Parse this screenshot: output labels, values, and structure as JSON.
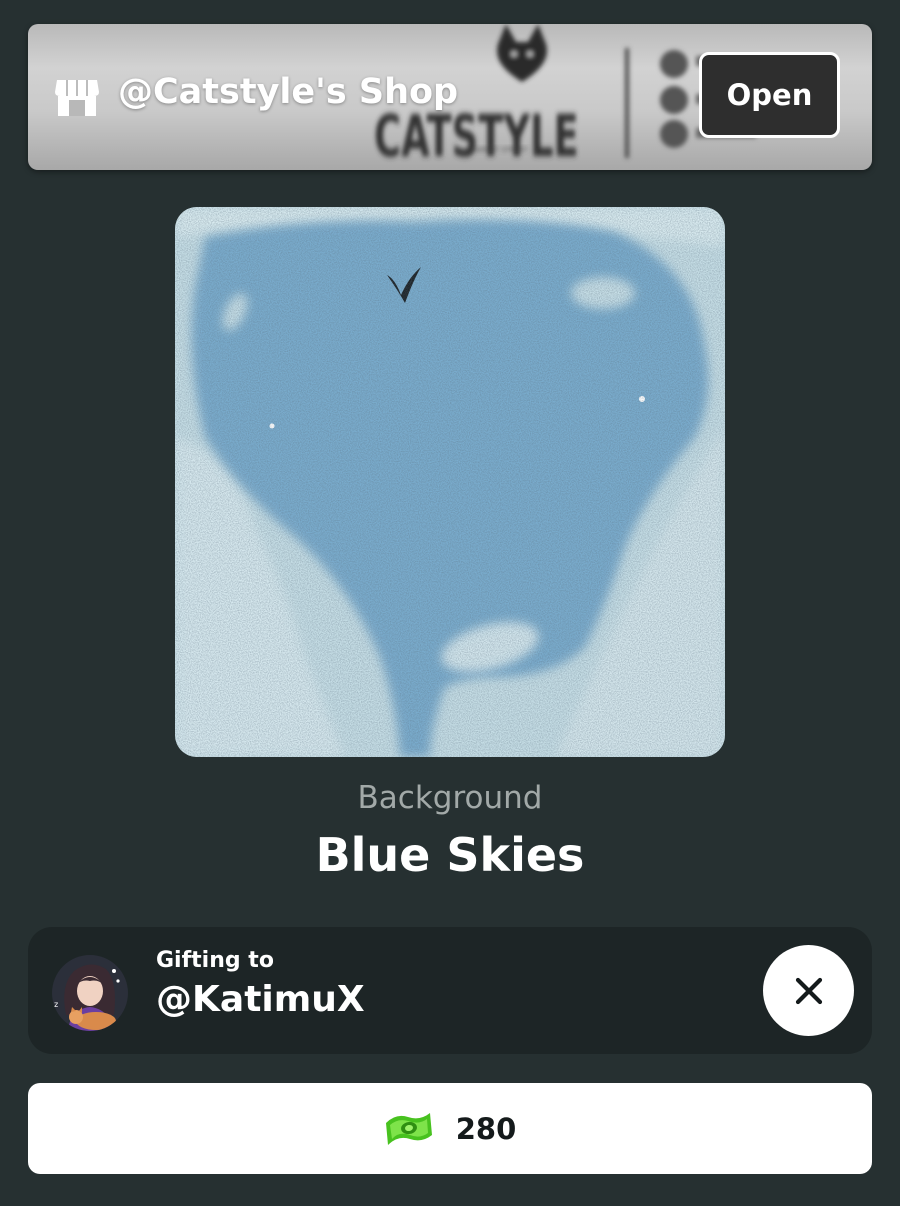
{
  "shop": {
    "title": "@Catstyle's Shop",
    "open_label": "Open",
    "banner_logo_text": "CATSTYLE"
  },
  "item": {
    "category": "Background",
    "name": "Blue Skies"
  },
  "gift": {
    "label": "Gifting to",
    "recipient": "@KatimuX"
  },
  "purchase": {
    "price": "280"
  },
  "colors": {
    "background": "#263031",
    "panel": "#1d2526",
    "sky": "#7aaccd",
    "cloud": "#c6dee6",
    "currency_green": "#48c21f"
  },
  "icons": {
    "shop": "storefront-icon",
    "close": "close-icon",
    "currency": "cash-icon"
  }
}
